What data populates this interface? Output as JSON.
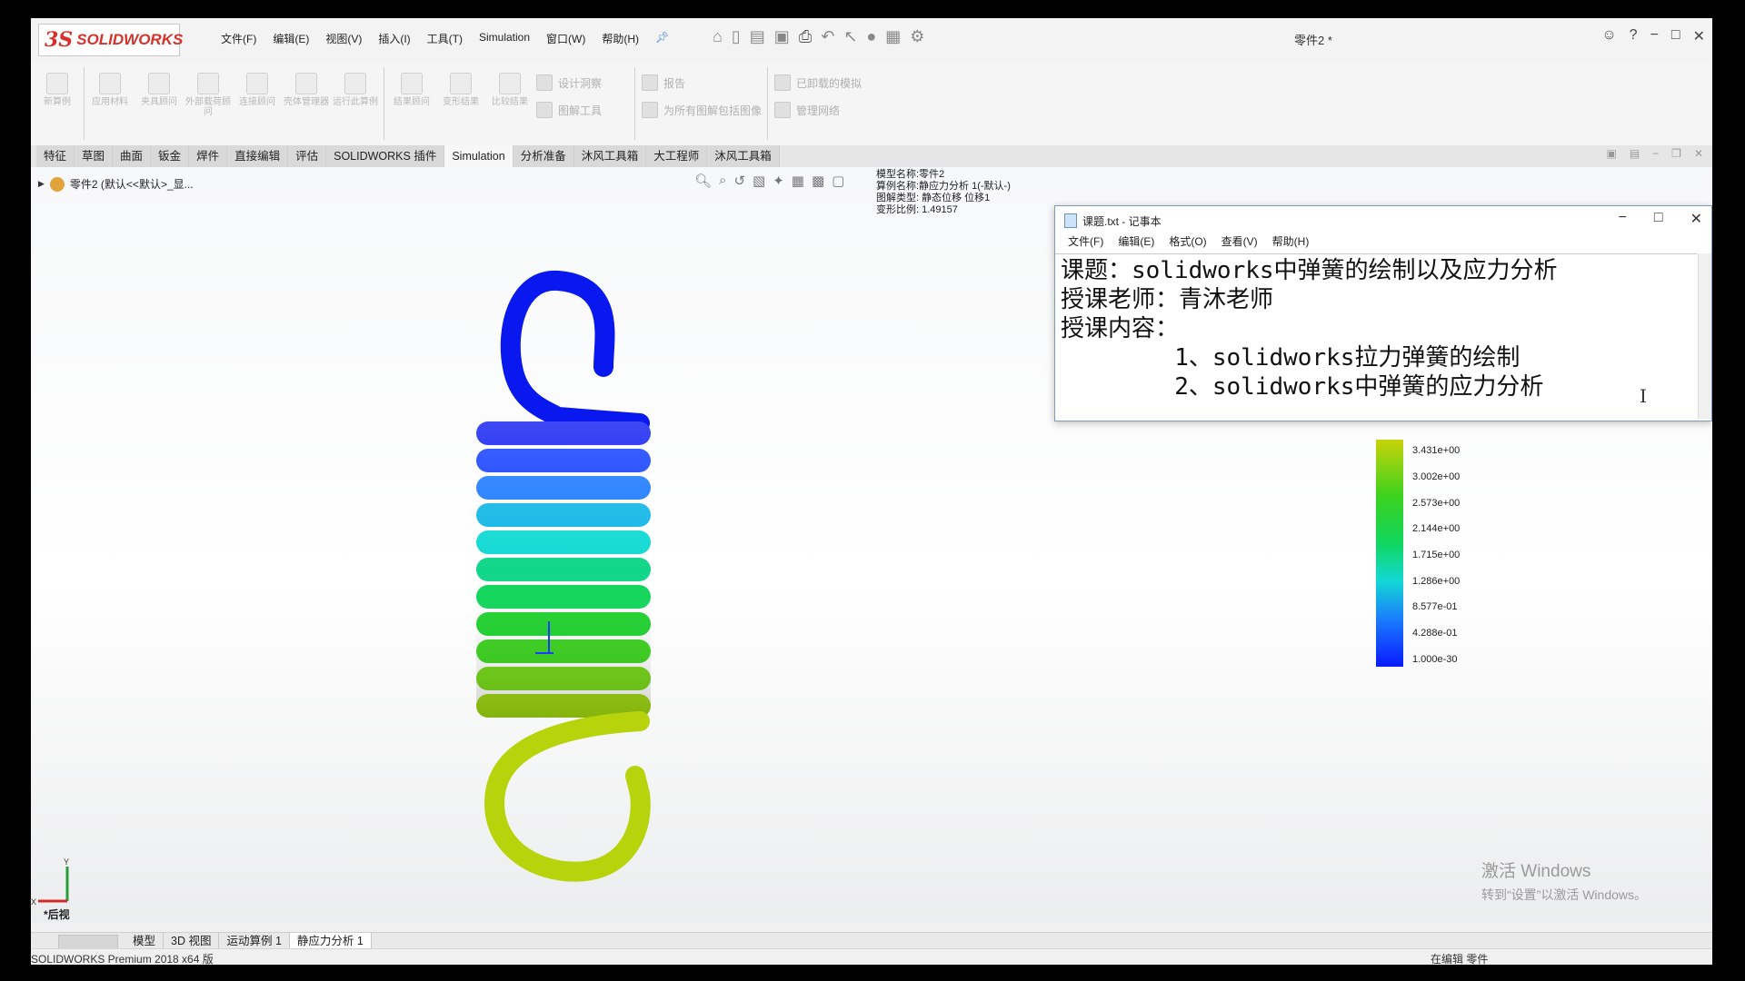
{
  "app": {
    "logo_mark": "3S",
    "logo_text": "SOLIDWORKS",
    "document_title": "零件2 *",
    "menus": [
      "文件(F)",
      "编辑(E)",
      "视图(V)",
      "插入(I)",
      "工具(T)",
      "Simulation",
      "窗口(W)",
      "帮助(H)"
    ]
  },
  "commands": {
    "left_tools": [
      "新算例",
      "应用材料",
      "夹具顾问",
      "外部载荷顾问",
      "连接顾问",
      "壳体管理器",
      "运行此算例",
      "结果顾问",
      "变形结果",
      "比较结果"
    ],
    "right_tools": [
      "设计洞察",
      "图解工具",
      "报告",
      "为所有图解包括图像",
      "已卸载的模拟",
      "管理网络"
    ]
  },
  "tabs": [
    "特征",
    "草图",
    "曲面",
    "钣金",
    "焊件",
    "直接编辑",
    "评估",
    "SOLIDWORKS 插件",
    "Simulation",
    "分析准备",
    "沐风工具箱",
    "大工程师",
    "沐风工具箱"
  ],
  "active_tab_index": 8,
  "tree": {
    "label": "零件2 (默认<<默认>_显..."
  },
  "study_info": {
    "line1": "模型名称:零件2",
    "line2": "算例名称:静应力分析 1(-默认-)",
    "line3": "图解类型: 静态位移 位移1",
    "line4": "变形比例: 1.49157"
  },
  "legend": {
    "labels": [
      "3.431e+00",
      "3.002e+00",
      "2.573e+00",
      "2.144e+00",
      "1.715e+00",
      "1.286e+00",
      "8.577e-01",
      "4.288e-01",
      "1.000e-30"
    ]
  },
  "view_label": "*后视",
  "triad": {
    "y": "Y",
    "x": "X"
  },
  "bottom_tabs": [
    "模型",
    "3D 视图",
    "运动算例 1",
    "静应力分析 1"
  ],
  "active_bottom_tab_index": 3,
  "status": {
    "left": "SOLIDWORKS Premium 2018 x64 版",
    "right": "在编辑 零件"
  },
  "notepad": {
    "title": "课题.txt - 记事本",
    "menus": [
      "文件(F)",
      "编辑(E)",
      "格式(O)",
      "查看(V)",
      "帮助(H)"
    ],
    "lines": [
      "课题：solidworks中弹簧的绘制以及应力分析",
      "授课老师：青沐老师",
      "授课内容：",
      "        1、solidworks拉力弹簧的绘制",
      "        2、solidworks中弹簧的应力分析"
    ]
  },
  "watermark": {
    "line1": "激活 Windows",
    "line2": "转到“设置”以激活 Windows。"
  },
  "colors": {
    "brand_red": "#d6322b",
    "notepad_border": "#7a9cc4"
  }
}
